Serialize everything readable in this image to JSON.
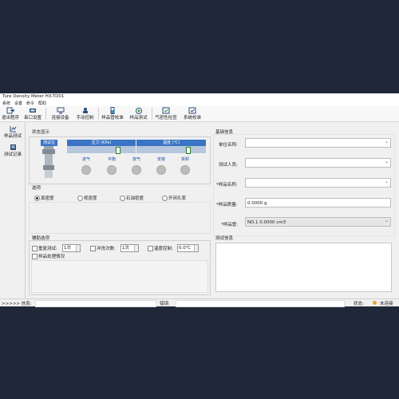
{
  "window": {
    "title": "Ture Density Meter HX-TD01"
  },
  "menu": [
    "系统",
    "设置",
    "命令",
    "帮助"
  ],
  "toolbar": [
    "退出程序",
    "串口设置",
    "连接设备",
    "手动控制",
    "样品管校准",
    "样品测试",
    "气密性检查",
    "系统校准"
  ],
  "sidebar": [
    "样品测试",
    "测试记录"
  ],
  "status_panel": {
    "title": "状态显示",
    "col_test": "测试位",
    "col_pressure": "压力 (KPa)",
    "col_temp": "温度 (℃)",
    "pressure_value": "0",
    "temp_value": "0",
    "valves": [
      "进气",
      "平衡",
      "放气",
      "安装",
      "拆卸"
    ]
  },
  "options": {
    "title": "选项",
    "radios": [
      "真密度",
      "视密度",
      "石油密度",
      "开闭孔率"
    ],
    "selected": "真密度"
  },
  "aux": {
    "title": "辅助选项",
    "repeat_label": "重复测试:",
    "repeat_value": "1次",
    "wash_label": "冲洗次数:",
    "wash_value": "1次",
    "temp_label": "温度控制:",
    "temp_value": "0.0℃",
    "process_label": "样品处理情况"
  },
  "base_info": {
    "title": "基础信息",
    "unit_label": "单位名称:",
    "tester_label": "测试人员:",
    "sample_name_label": "*样品名称:",
    "sample_mass_label": "*样品质量:",
    "sample_mass_value": "0.0000 g",
    "tube_label": "*样品管:",
    "tube_value": "NO.1 0.0000 cm3"
  },
  "test_info": {
    "title": "测试信息"
  },
  "statusbar": {
    "info_label": ">>>>> 信息:",
    "error_label": "错误:",
    "state_label": "状态:",
    "state_value": "未连接"
  },
  "colors": {
    "accent": "#3a74c4",
    "status_dot": "#f0a030",
    "background": "#1e2838"
  }
}
